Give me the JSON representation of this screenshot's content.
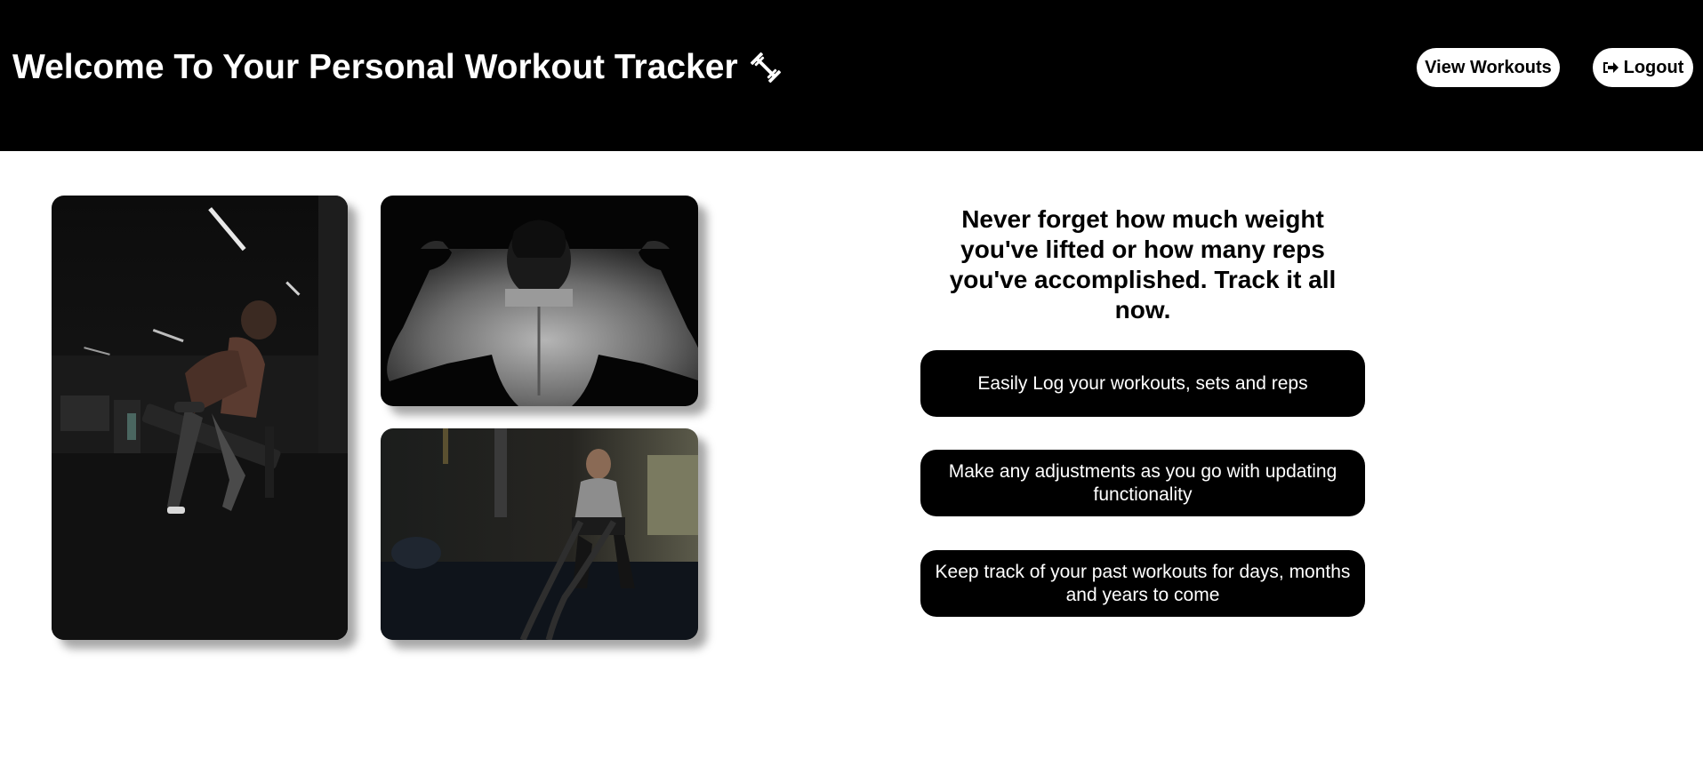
{
  "header": {
    "title": "Welcome To Your Personal Workout Tracker",
    "title_icon": "dumbbell-icon",
    "nav": {
      "view_workouts_label": "View Workouts",
      "logout_label": "Logout",
      "logout_icon": "sign-out-icon"
    }
  },
  "gallery": [
    {
      "name": "woman-dumbbell-row-photo"
    },
    {
      "name": "man-flexing-back-photo"
    },
    {
      "name": "man-battle-ropes-photo"
    }
  ],
  "hero": {
    "tagline": "Never forget how much weight you've lifted or how many reps you've accomplished. Track it all now.",
    "features": [
      "Easily Log your workouts, sets and reps",
      "Make any adjustments as you go with updating functionality",
      "Keep track of your past workouts for days, months and years to come"
    ]
  },
  "colors": {
    "header_bg": "#000000",
    "button_bg": "#ffffff",
    "feature_bg": "#000000",
    "page_bg": "#ffffff"
  }
}
